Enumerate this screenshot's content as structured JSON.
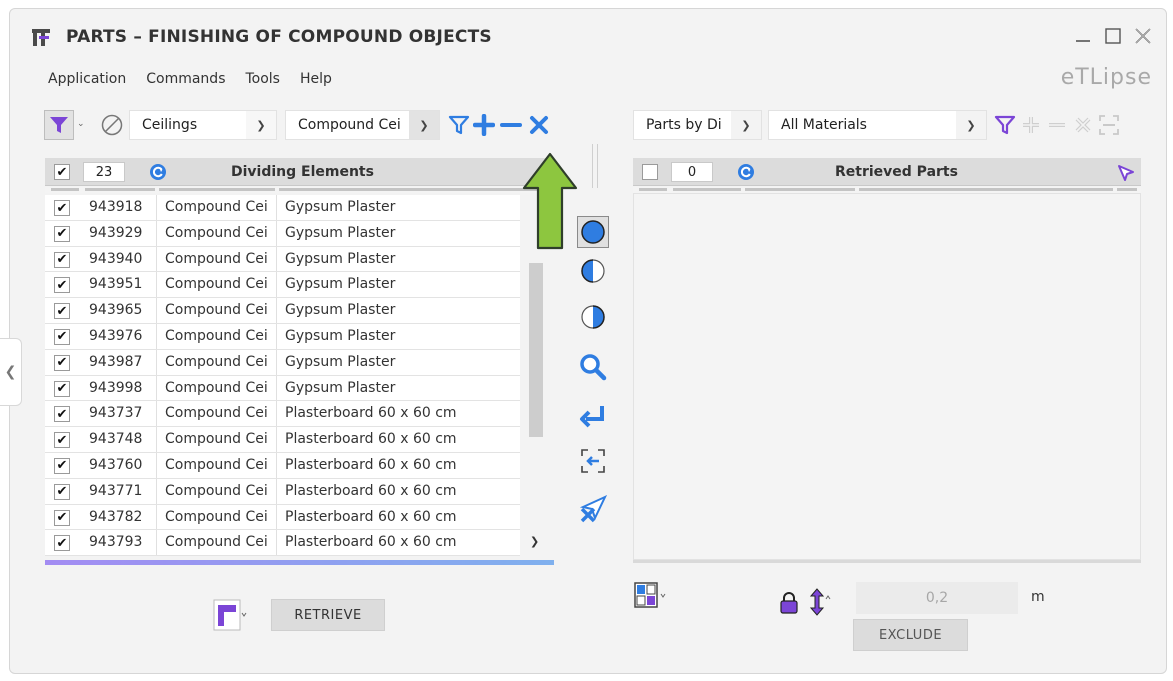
{
  "window": {
    "title": "PARTS – FINISHING OF COMPOUND OBJECTS",
    "brand": "eTLipse",
    "controls": [
      "minimize-icon",
      "maximize-icon",
      "close-icon"
    ]
  },
  "menu": [
    "Application",
    "Commands",
    "Tools",
    "Help"
  ],
  "left_toolbar": {
    "category_select": "Ceilings",
    "type_select": "Compound Cei",
    "icons": [
      "filter-icon",
      "no-entry-icon",
      "filter-icon",
      "plus-icon",
      "minus-icon",
      "x-icon"
    ]
  },
  "left_table": {
    "selected_count": "23",
    "title": "Dividing Elements",
    "rows": [
      {
        "id": "943918",
        "type": "Compound Cei",
        "material": "Gypsum Plaster",
        "checked": true
      },
      {
        "id": "943929",
        "type": "Compound Cei",
        "material": "Gypsum Plaster",
        "checked": true
      },
      {
        "id": "943940",
        "type": "Compound Cei",
        "material": "Gypsum Plaster",
        "checked": true
      },
      {
        "id": "943951",
        "type": "Compound Cei",
        "material": "Gypsum Plaster",
        "checked": true
      },
      {
        "id": "943965",
        "type": "Compound Cei",
        "material": "Gypsum Plaster",
        "checked": true
      },
      {
        "id": "943976",
        "type": "Compound Cei",
        "material": "Gypsum Plaster",
        "checked": true
      },
      {
        "id": "943987",
        "type": "Compound Cei",
        "material": "Gypsum Plaster",
        "checked": true
      },
      {
        "id": "943998",
        "type": "Compound Cei",
        "material": "Gypsum Plaster",
        "checked": true
      },
      {
        "id": "943737",
        "type": "Compound Cei",
        "material": "Plasterboard 60 x 60 cm",
        "checked": true
      },
      {
        "id": "943748",
        "type": "Compound Cei",
        "material": "Plasterboard 60 x 60 cm",
        "checked": true
      },
      {
        "id": "943760",
        "type": "Compound Cei",
        "material": "Plasterboard 60 x 60 cm",
        "checked": true
      },
      {
        "id": "943771",
        "type": "Compound Cei",
        "material": "Plasterboard 60 x 60 cm",
        "checked": true
      },
      {
        "id": "943782",
        "type": "Compound Cei",
        "material": "Plasterboard 60 x 60 cm",
        "checked": true
      },
      {
        "id": "943793",
        "type": "Compound Cei",
        "material": "Plasterboard 60 x 60 cm",
        "checked": true
      }
    ]
  },
  "left_footer": {
    "retrieve_label": "RETRIEVE"
  },
  "middle_icons": [
    "full-circle-icon",
    "half-circle-left-icon",
    "half-circle-right-icon",
    "magnifier-icon",
    "return-arrow-icon",
    "select-back-icon",
    "cursor-cross-icon"
  ],
  "right_toolbar": {
    "mode_select": "Parts by Di",
    "material_select": "All Materials"
  },
  "right_table": {
    "selected_count": "0",
    "title": "Retrieved Parts"
  },
  "right_footer": {
    "offset_value": "0,2",
    "unit": "m",
    "exclude_label": "EXCLUDE"
  },
  "colors": {
    "accent_blue": "#2f7de1",
    "accent_purple": "#7b45d6",
    "callout_green": "#8dc63f"
  }
}
